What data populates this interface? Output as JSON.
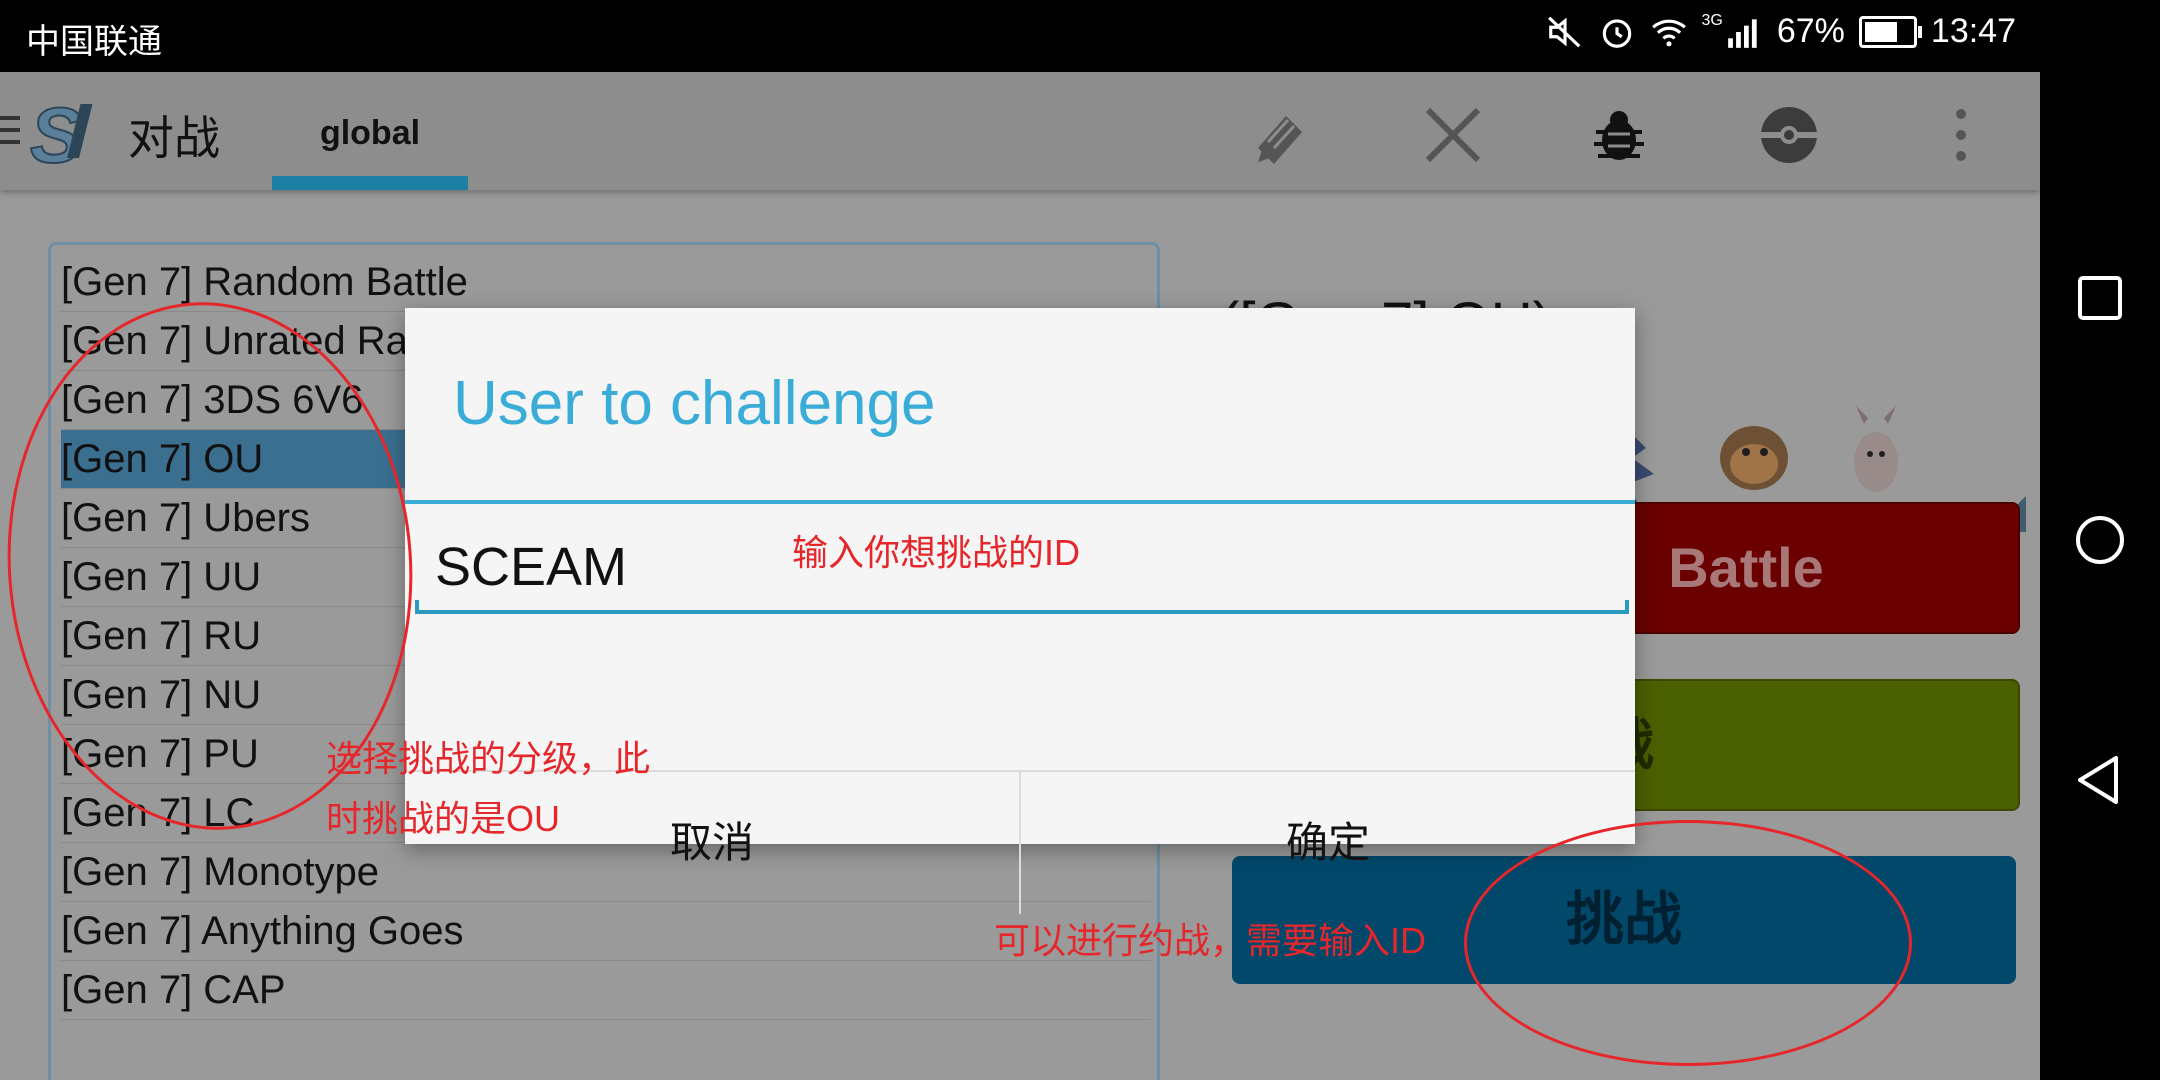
{
  "status_bar": {
    "carrier": "中国联通",
    "network": "3G",
    "battery": "67%",
    "time": "13:47",
    "battery_level": 0.67
  },
  "app_bar": {
    "title": "对战",
    "tab": "global",
    "icons": [
      "edit-icon",
      "close-icon",
      "bug-icon",
      "pokeball-icon",
      "more-vert-icon"
    ]
  },
  "formats": [
    "[Gen 7] Random Battle",
    "[Gen 7] Unrated Ra",
    "[Gen 7] 3DS 6V6",
    "[Gen 7] OU",
    "[Gen 7] Ubers",
    "[Gen 7] UU",
    "[Gen 7] RU",
    "[Gen 7] NU",
    "[Gen 7] PU",
    "[Gen 7] LC",
    "[Gen 7] Monotype",
    "[Gen 7] Anything Goes",
    "[Gen 7] CAP"
  ],
  "selected_format": "[Gen 7] OU",
  "team": {
    "title": "([Gen 7] OU)"
  },
  "buttons": {
    "battle": "Battle",
    "green": "战",
    "challenge": "挑战"
  },
  "dialog": {
    "title": "User to challenge",
    "input_value": "SCEAM",
    "cancel": "取消",
    "ok": "确定"
  },
  "annotations": {
    "input_hint": "输入你想挑战的ID",
    "format_hint_line1": "选择挑战的分级，此",
    "format_hint_line2": "时挑战的是OU",
    "challenge_hint": "可以进行约战，需要输入ID"
  },
  "colors": {
    "accent": "#39acd8",
    "annotation": "#e5262a",
    "challenge_button": "#02486b",
    "battle_button": "#6a0000"
  }
}
